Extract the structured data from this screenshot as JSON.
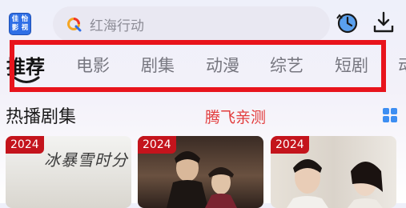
{
  "header": {
    "logo_text": [
      "佳",
      "怡",
      "影",
      "视"
    ],
    "search": {
      "placeholder": "红海行动"
    }
  },
  "nav": {
    "tabs": [
      {
        "label": "推荐",
        "active": true
      },
      {
        "label": "电影"
      },
      {
        "label": "剧集"
      },
      {
        "label": "动漫"
      },
      {
        "label": "综艺"
      },
      {
        "label": "短剧"
      },
      {
        "label": "动"
      }
    ]
  },
  "section": {
    "title": "热播剧集",
    "promo": "腾飞亲测"
  },
  "cards": [
    {
      "year": "2024",
      "poster_title": "冰暴雪时分"
    },
    {
      "year": "2024"
    },
    {
      "year": "2024"
    }
  ],
  "colors": {
    "accent": "#e8141c",
    "logo_blue": "#2f6fe6",
    "year_badge": "#c4141c",
    "promo": "#e23b3b"
  }
}
